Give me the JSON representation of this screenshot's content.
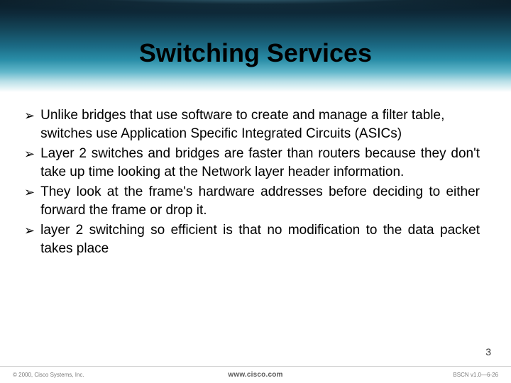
{
  "title": "Switching Services",
  "bullets": [
    {
      "marker": "➢",
      "text": "Unlike bridges that use software to create and manage a filter table, switches use Application Specific Integrated Circuits (ASICs)",
      "justify": false
    },
    {
      "marker": "➢",
      "text": "Layer 2 switches and bridges are faster than routers because they don't take up time looking at the Network layer header information.",
      "justify": true
    },
    {
      "marker": "➢",
      "text": "They look at the frame's hardware addresses before deciding to either forward the frame or drop it.",
      "justify": true
    },
    {
      "marker": "➢",
      "text": "layer 2 switching so efficient is that no modification to the data packet takes place",
      "justify": true
    }
  ],
  "page_number": "3",
  "footer": {
    "left": "© 2000, Cisco Systems, Inc.",
    "center": "www.cisco.com",
    "right": "BSCN v1.0—6-26"
  }
}
